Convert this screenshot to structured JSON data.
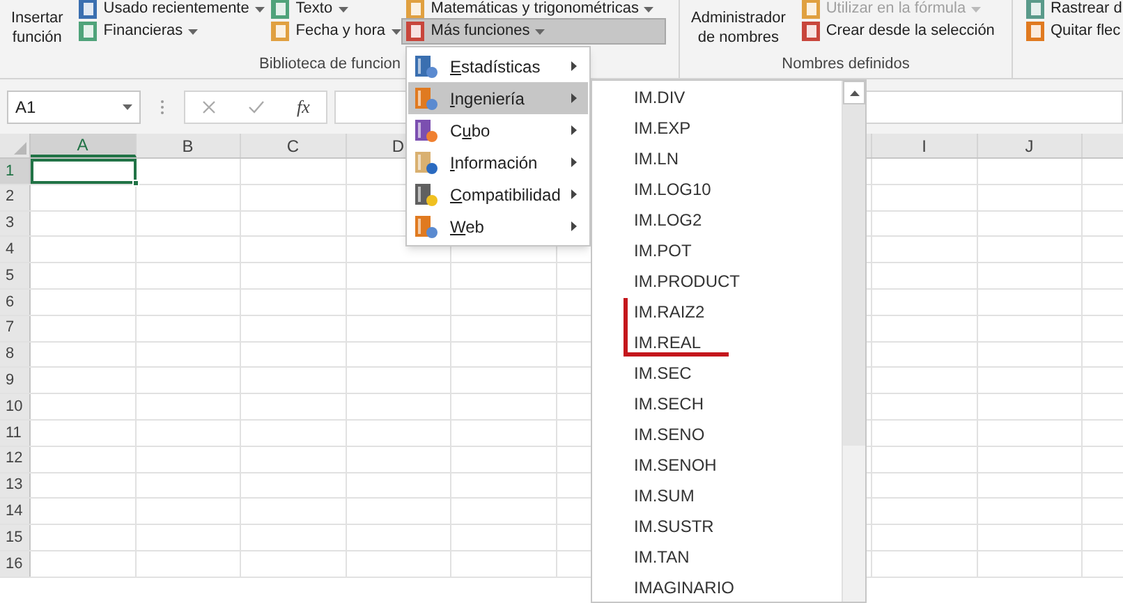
{
  "ribbon": {
    "groups": [
      {
        "label": "Biblioteca de funcion",
        "large_button": {
          "lines": [
            "Insertar",
            "función"
          ]
        },
        "columns": [
          [
            {
              "label": "Usado recientemente",
              "dropdown": true,
              "selected": false
            },
            {
              "label": "Financieras",
              "dropdown": true,
              "selected": false
            }
          ],
          [
            {
              "label": "Texto",
              "dropdown": true,
              "selected": false
            },
            {
              "label": "Fecha y hora",
              "dropdown": true,
              "selected": false
            }
          ],
          [
            {
              "label": "Matemáticas y trigonométricas",
              "dropdown": true,
              "selected": false
            },
            {
              "label": "Más funciones",
              "dropdown": true,
              "selected": true
            }
          ]
        ]
      },
      {
        "label": "Nombres definidos",
        "large_button": {
          "lines": [
            "Administrador",
            "de nombres"
          ]
        },
        "columns": [
          [
            {
              "label": "Utilizar en la fórmula",
              "dropdown": true,
              "disabled": true
            },
            {
              "label": "Crear desde la selección",
              "dropdown": false,
              "disabled": false
            }
          ]
        ]
      },
      {
        "columns": [
          [
            {
              "label": "Rastrear d"
            },
            {
              "label": "Quitar flec"
            }
          ]
        ]
      }
    ]
  },
  "formula_bar": {
    "name_box": "A1",
    "fx": "fx"
  },
  "sheet": {
    "columns_left": [
      {
        "label": "A",
        "selected": true
      },
      {
        "label": "B",
        "selected": false
      },
      {
        "label": "C",
        "selected": false
      },
      {
        "label": "D",
        "selected": false
      }
    ],
    "columns_right": [
      {
        "label": "I",
        "selected": false
      },
      {
        "label": "J",
        "selected": false
      }
    ],
    "rows": [
      {
        "label": "1",
        "selected": true
      },
      {
        "label": "2",
        "selected": false
      },
      {
        "label": "3",
        "selected": false
      },
      {
        "label": "4",
        "selected": false
      },
      {
        "label": "5",
        "selected": false
      },
      {
        "label": "6",
        "selected": false
      },
      {
        "label": "7",
        "selected": false
      },
      {
        "label": "8",
        "selected": false
      },
      {
        "label": "9",
        "selected": false
      },
      {
        "label": "10",
        "selected": false
      },
      {
        "label": "11",
        "selected": false
      },
      {
        "label": "12",
        "selected": false
      },
      {
        "label": "13",
        "selected": false
      },
      {
        "label": "14",
        "selected": false
      },
      {
        "label": "15",
        "selected": false
      },
      {
        "label": "16",
        "selected": false
      }
    ]
  },
  "menu": {
    "items": [
      {
        "accelerator": "E",
        "label_rest": "stadísticas",
        "selected": false
      },
      {
        "accelerator": "I",
        "label_rest": "ngeniería",
        "selected": true
      },
      {
        "label_start": "C",
        "accelerator": "u",
        "label_rest": "bo",
        "selected": false
      },
      {
        "accelerator": "I",
        "label_rest": "nformación",
        "selected": false
      },
      {
        "accelerator": "C",
        "label_rest": "ompatibilidad",
        "selected": false
      },
      {
        "accelerator": "W",
        "label_rest": "eb",
        "selected": false
      }
    ]
  },
  "submenu": {
    "items": [
      "IM.DIV",
      "IM.EXP",
      "IM.LN",
      "IM.LOG10",
      "IM.LOG2",
      "IM.POT",
      "IM.PRODUCT",
      "IM.RAIZ2",
      "IM.REAL",
      "IM.SEC",
      "IM.SECH",
      "IM.SENO",
      "IM.SENOH",
      "IM.SUM",
      "IM.SUSTR",
      "IM.TAN",
      "IMAGINARIO"
    ]
  }
}
